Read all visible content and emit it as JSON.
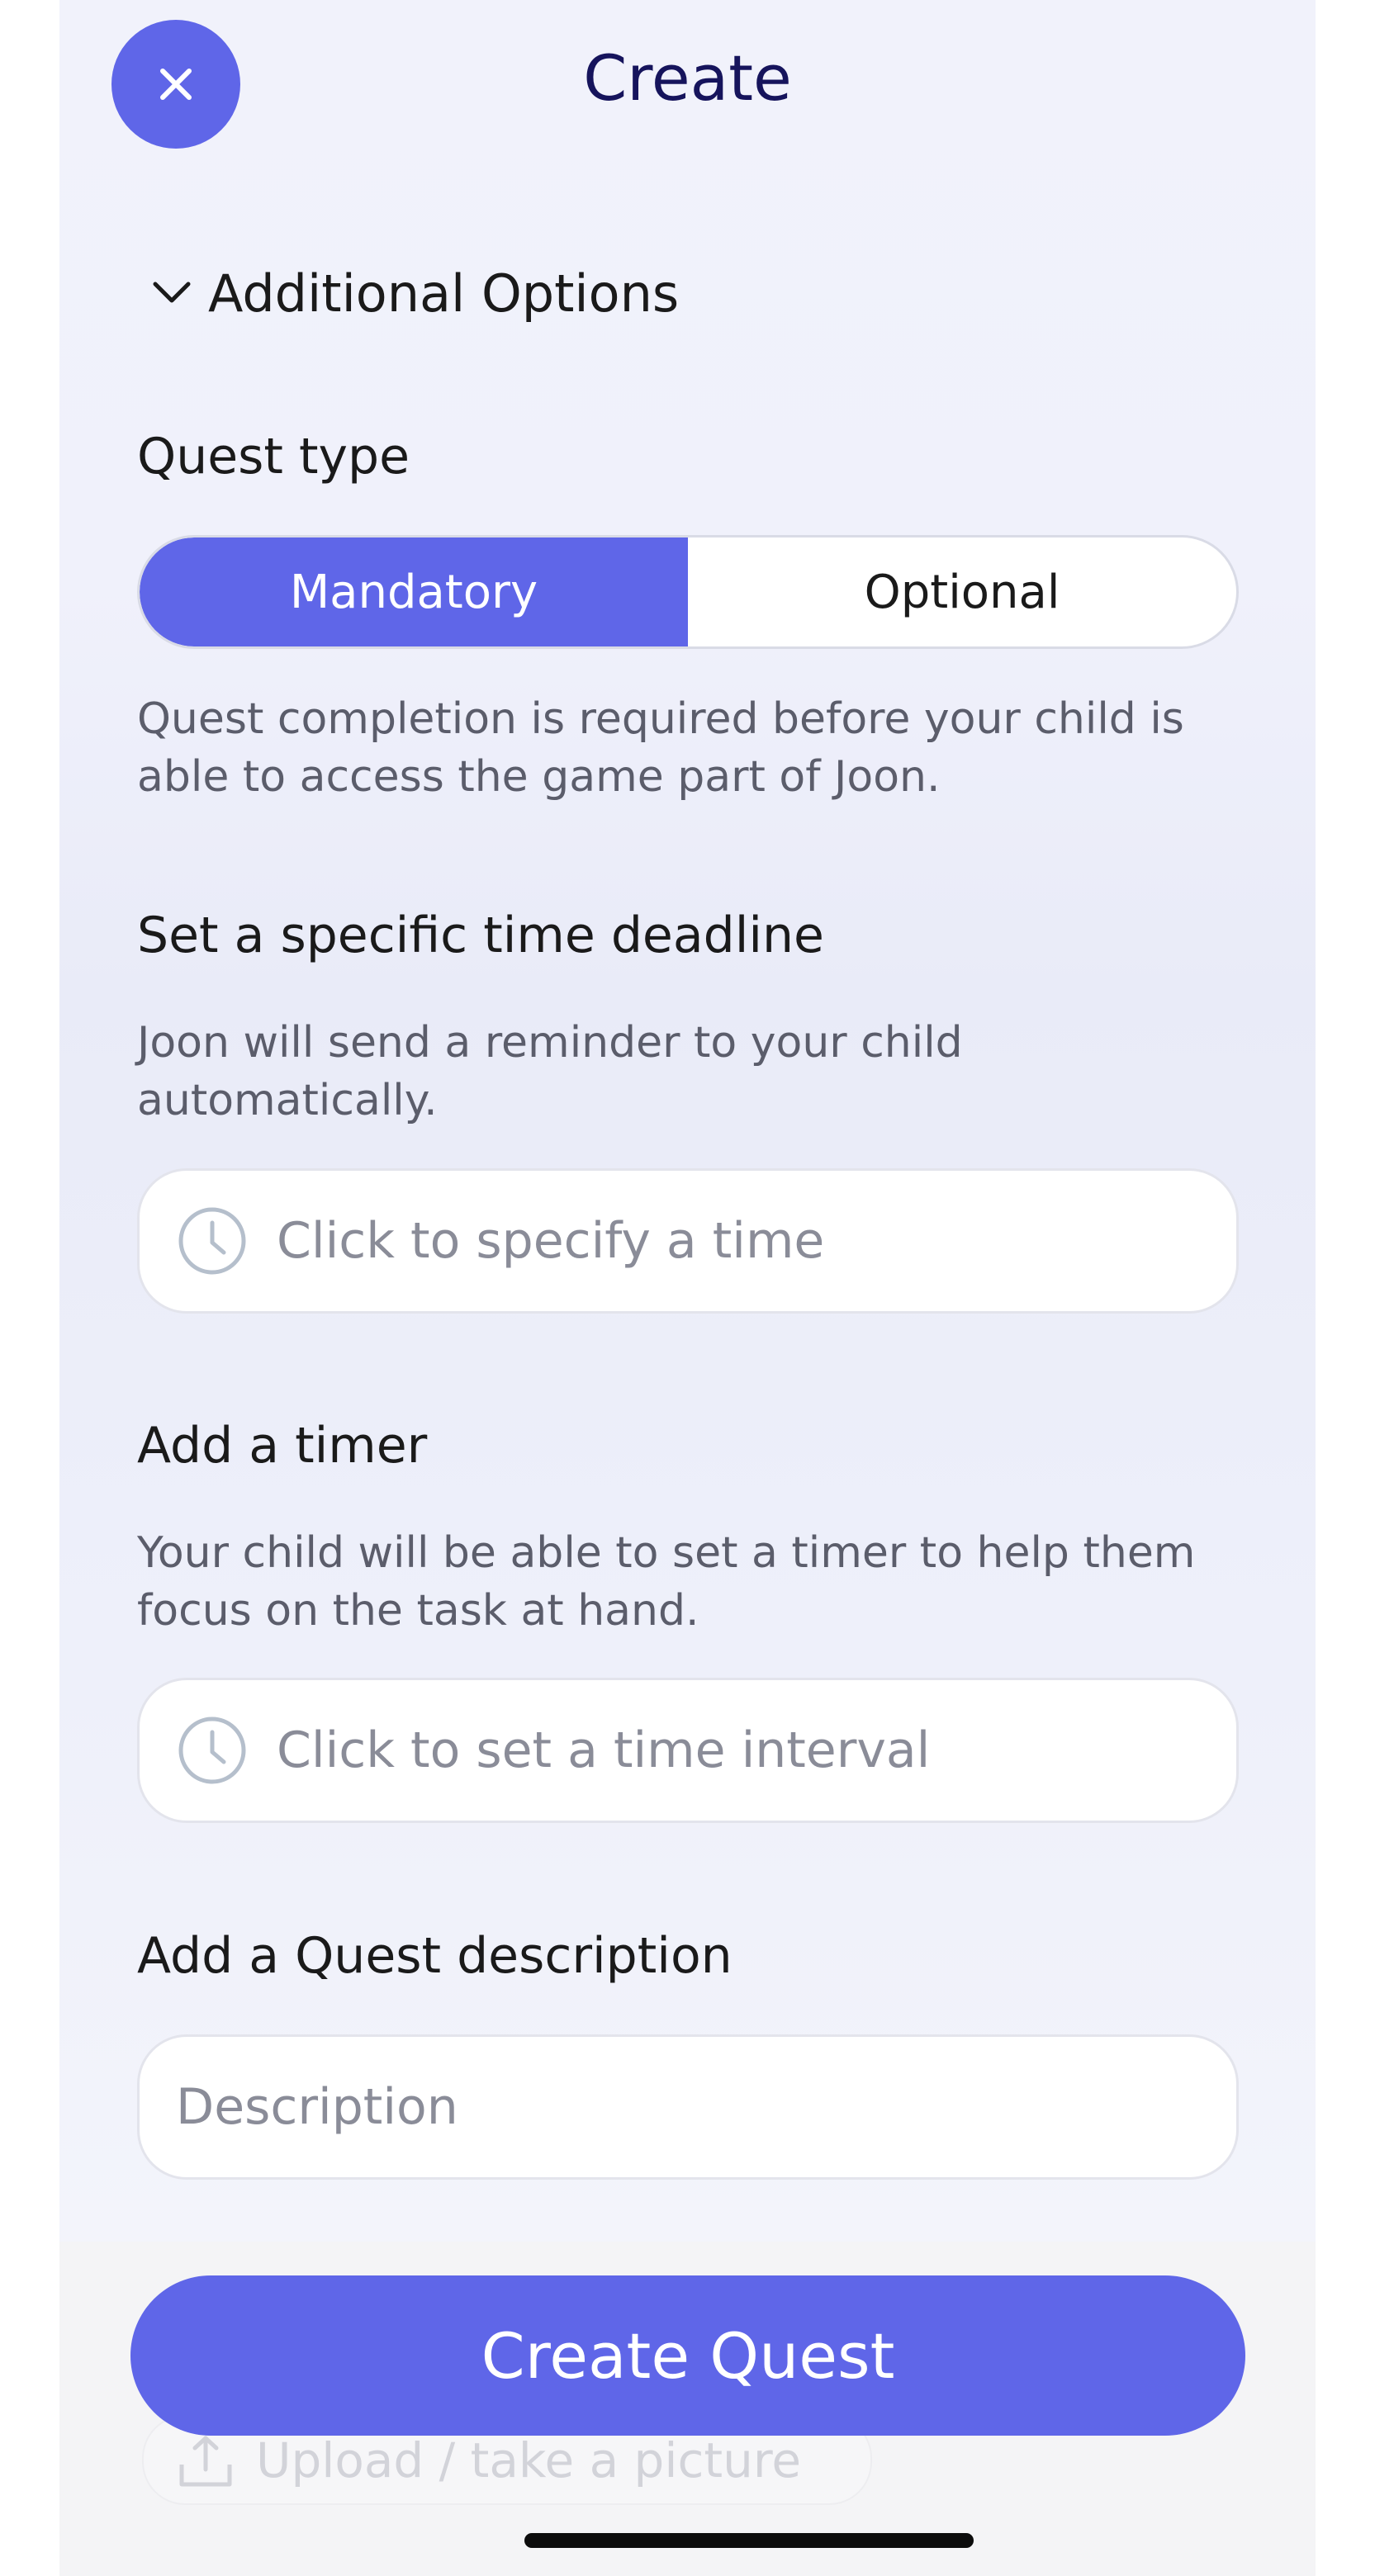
{
  "header": {
    "title": "Create"
  },
  "additional_options": {
    "label": "Additional Options"
  },
  "quest_type": {
    "label": "Quest type",
    "options": [
      "Mandatory",
      "Optional"
    ],
    "selected": "Mandatory",
    "helper": "Quest completion is required before your child is able to access the game part of Joon."
  },
  "deadline": {
    "label": "Set a specific time deadline",
    "helper": "Joon will send a reminder to your child automatically.",
    "placeholder": "Click to specify a time"
  },
  "timer": {
    "label": "Add a timer",
    "helper": "Your child will be able to set a timer to help them focus on the task at hand.",
    "placeholder": "Click to set a time interval"
  },
  "description": {
    "label": "Add a Quest description",
    "placeholder": "Description"
  },
  "photo": {
    "label": "Upload / take a picture"
  },
  "actions": {
    "create_label": "Create Quest"
  },
  "colors": {
    "accent": "#5f66e8",
    "title": "#16145c"
  },
  "icons": {
    "close": "close-icon",
    "chevron": "chevron-down-icon",
    "clock": "clock-icon",
    "upload": "upload-icon"
  }
}
